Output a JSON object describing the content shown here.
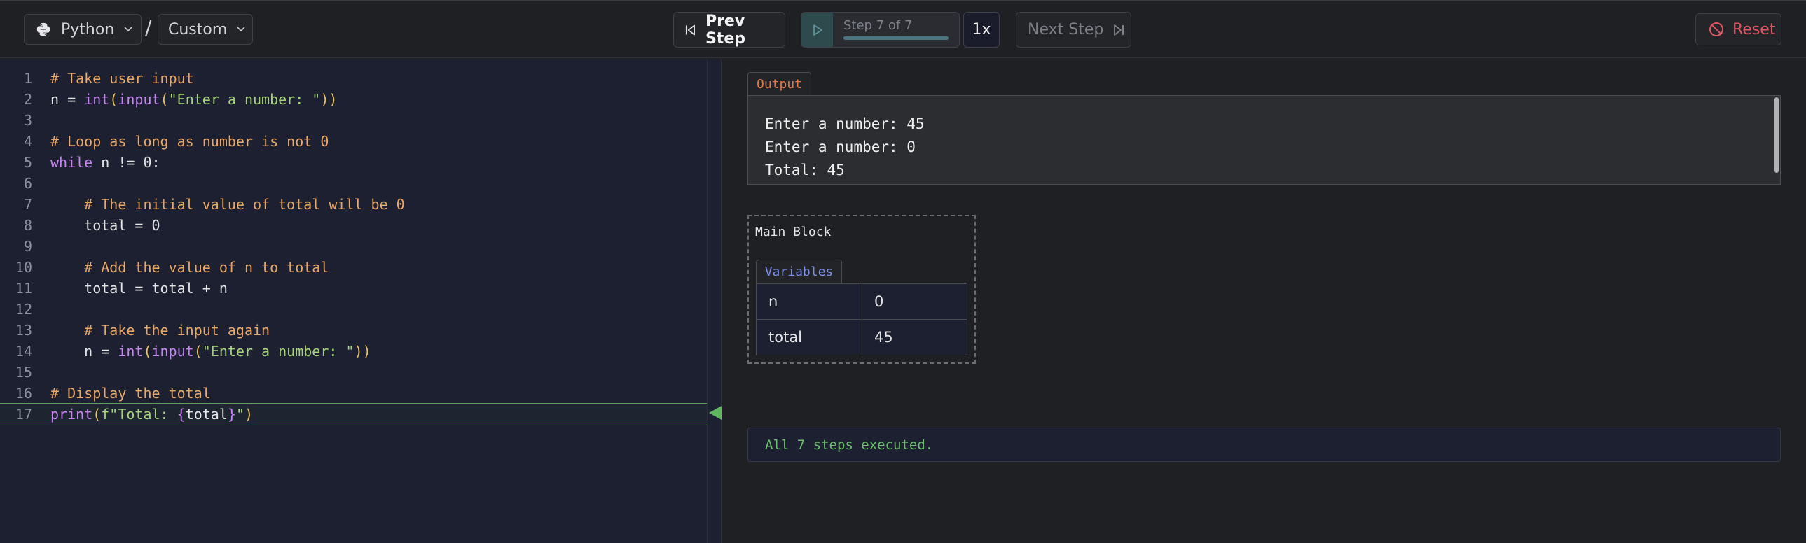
{
  "header": {
    "language": "Python",
    "separator": "/",
    "mode": "Custom",
    "prev_label": "Prev Step",
    "step_label": "Step 7 of 7",
    "progress": 1.0,
    "speed": "1x",
    "next_label": "Next Step",
    "reset_label": "Reset"
  },
  "code": {
    "active_line": 17,
    "lines": [
      {
        "n": "1"
      },
      {
        "n": "2"
      },
      {
        "n": "3"
      },
      {
        "n": "4"
      },
      {
        "n": "5"
      },
      {
        "n": "6"
      },
      {
        "n": "7"
      },
      {
        "n": "8"
      },
      {
        "n": "9"
      },
      {
        "n": "10"
      },
      {
        "n": "11"
      },
      {
        "n": "12"
      },
      {
        "n": "13"
      },
      {
        "n": "14"
      },
      {
        "n": "15"
      },
      {
        "n": "16"
      },
      {
        "n": "17"
      }
    ],
    "tokens": {
      "l1": "# Take user input",
      "l2a": "n = ",
      "l2b": "int",
      "l2c": "(",
      "l2d": "input",
      "l2e": "(",
      "l2f": "\"Enter a number: \"",
      "l2g": "))",
      "l4": "# Loop as long as number is not 0",
      "l5a": "while",
      "l5b": " n != 0:",
      "l7": "    # The initial value of total will be 0",
      "l8": "    total = 0",
      "l10": "    # Add the value of n to total",
      "l11": "    total = total + n",
      "l13": "    # Take the input again",
      "l14a": "    n = ",
      "l14b": "int",
      "l14c": "(",
      "l14d": "input",
      "l14e": "(",
      "l14f": "\"Enter a number: \"",
      "l14g": "))",
      "l16": "# Display the total",
      "l17a": "print",
      "l17b": "(",
      "l17c": "f\"Total: ",
      "l17d": "{",
      "l17e": "total",
      "l17f": "}",
      "l17g": "\"",
      "l17h": ")"
    }
  },
  "output": {
    "tab_label": "Output",
    "lines": [
      "Enter a number: 45",
      "Enter a number: 0",
      "Total: 45"
    ]
  },
  "main_block": {
    "title": "Main Block",
    "variables_label": "Variables",
    "variables": [
      {
        "name": "n",
        "value": "0"
      },
      {
        "name": "total",
        "value": "45"
      }
    ]
  },
  "status": "All 7 steps executed.",
  "colors": {
    "accent_green": "#6ec06e",
    "reset_red": "#e05562",
    "output_orange": "#e0764a",
    "variables_blue": "#7b8ee8"
  }
}
